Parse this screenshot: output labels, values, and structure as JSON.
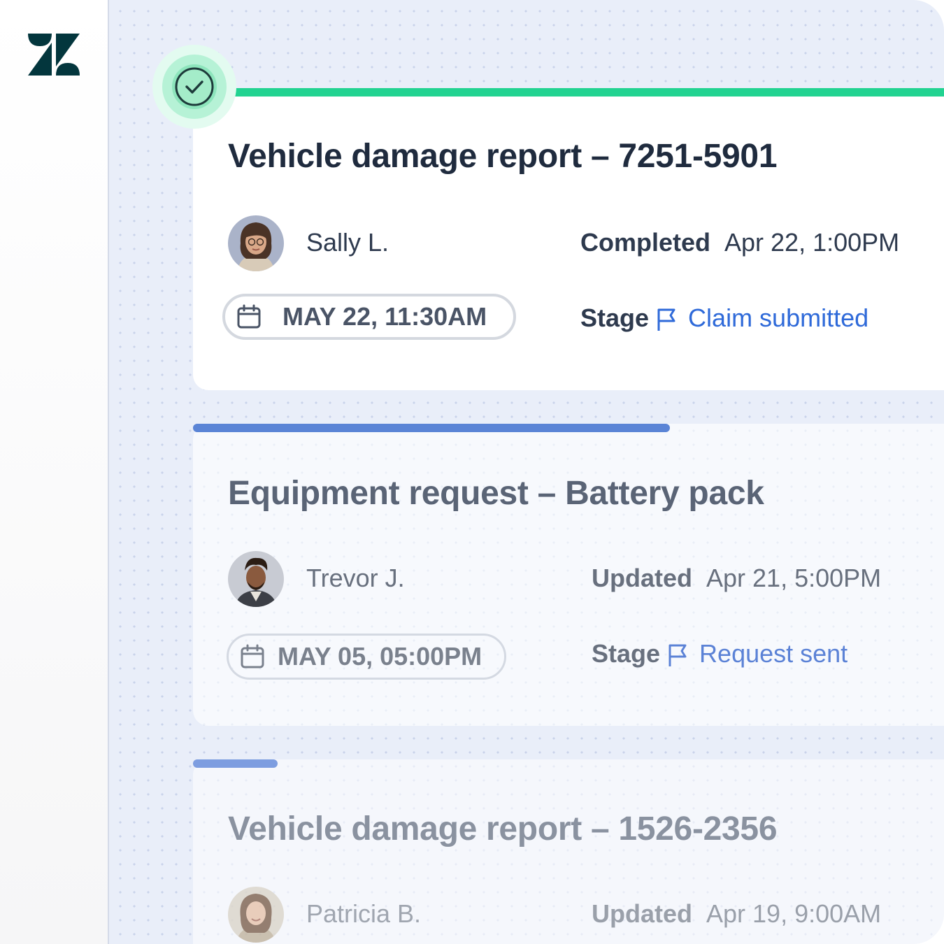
{
  "sidebar": {
    "logo": "zendesk-logo"
  },
  "tickets": [
    {
      "title": "Vehicle damage report – 7251-5901",
      "person": "Sally L.",
      "meta_key": "Completed",
      "meta_value": "Apr 22, 1:00PM",
      "date": "MAY 22, 11:30AM",
      "stage_key": "Stage",
      "stage_value": "Claim submitted",
      "status": "complete"
    },
    {
      "title": "Equipment request – Battery pack",
      "person": "Trevor J.",
      "meta_key": "Updated",
      "meta_value": "Apr 21, 5:00PM",
      "date": "MAY 05, 05:00PM",
      "stage_key": "Stage",
      "stage_value": "Request sent",
      "progress": 0.62
    },
    {
      "title": "Vehicle damage report – 1526-2356",
      "person": "Patricia B.",
      "meta_key": "Updated",
      "meta_value": "Apr 19, 9:00AM",
      "progress": 0.11
    }
  ],
  "colors": {
    "complete": "#22d391",
    "progress": "#5a84d6",
    "link": "#2f6ad9",
    "brand": "#03363d"
  },
  "icons": {
    "check": "check-icon",
    "calendar": "calendar-icon",
    "flag": "flag-icon"
  }
}
